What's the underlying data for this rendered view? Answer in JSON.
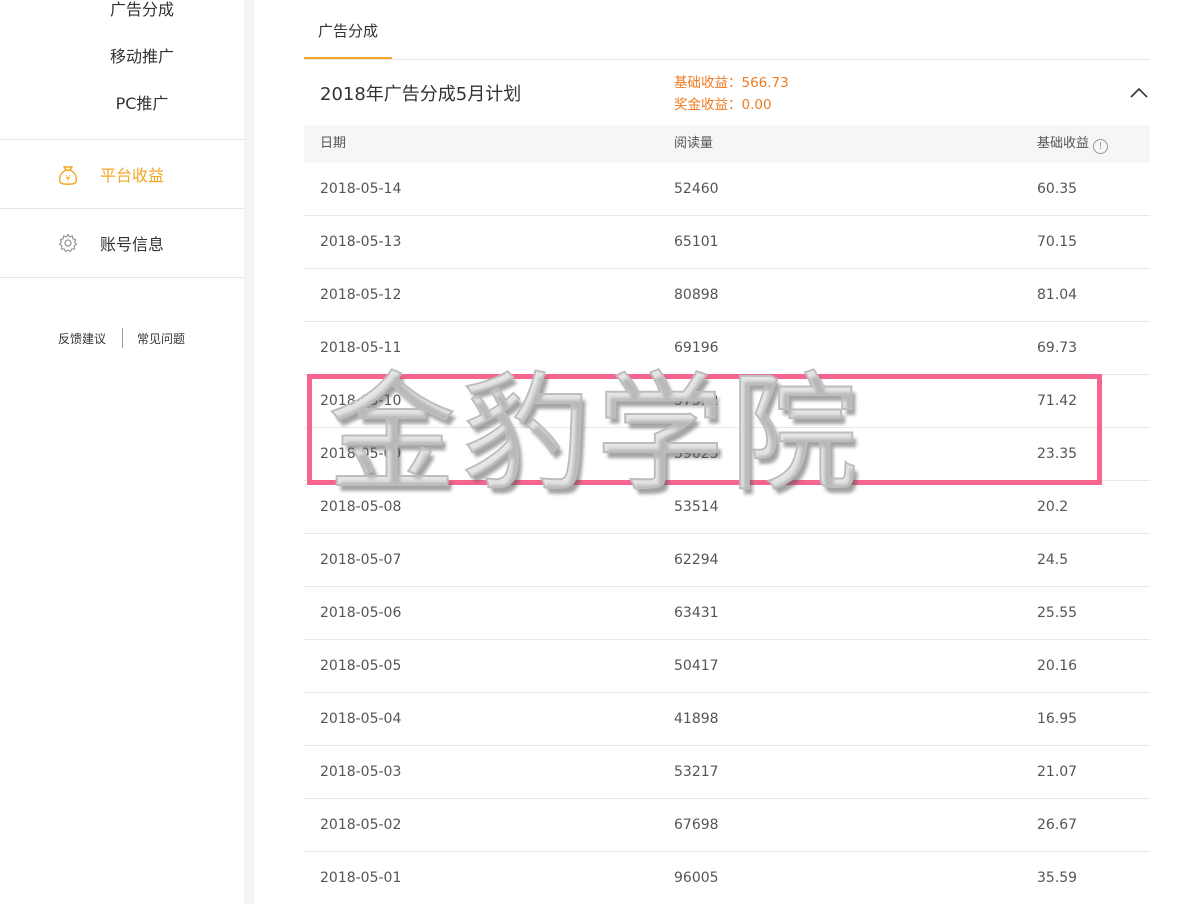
{
  "sidebar": {
    "sub_items": [
      {
        "label": "广告分成"
      },
      {
        "label": "移动推广"
      },
      {
        "label": "PC推广"
      }
    ],
    "nav": [
      {
        "label": "平台收益",
        "icon": "money-bag-icon",
        "active": true
      },
      {
        "label": "账号信息",
        "icon": "gear-icon",
        "active": false
      }
    ],
    "footer": {
      "feedback": "反馈建议",
      "faq": "常见问题"
    }
  },
  "tabs": [
    {
      "label": "广告分成",
      "active": true
    }
  ],
  "plan": {
    "title": "2018年广告分成5月计划",
    "base_income": "基础收益：566.73",
    "bonus_income": "奖金收益：0.00",
    "collapse_icon": "chevron-up-icon"
  },
  "table": {
    "headers": {
      "date": "日期",
      "reads": "阅读量",
      "income": "基础收益"
    },
    "rows": [
      {
        "date": "2018-05-14",
        "reads": "52460",
        "income": "60.35"
      },
      {
        "date": "2018-05-13",
        "reads": "65101",
        "income": "70.15"
      },
      {
        "date": "2018-05-12",
        "reads": "80898",
        "income": "81.04"
      },
      {
        "date": "2018-05-11",
        "reads": "69196",
        "income": "69.73"
      },
      {
        "date": "2018-05-10",
        "reads": "57512",
        "income": "71.42"
      },
      {
        "date": "2018-05-09",
        "reads": "59023",
        "income": "23.35"
      },
      {
        "date": "2018-05-08",
        "reads": "53514",
        "income": "20.2"
      },
      {
        "date": "2018-05-07",
        "reads": "62294",
        "income": "24.5"
      },
      {
        "date": "2018-05-06",
        "reads": "63431",
        "income": "25.55"
      },
      {
        "date": "2018-05-05",
        "reads": "50417",
        "income": "20.16"
      },
      {
        "date": "2018-05-04",
        "reads": "41898",
        "income": "16.95"
      },
      {
        "date": "2018-05-03",
        "reads": "53217",
        "income": "21.07"
      },
      {
        "date": "2018-05-02",
        "reads": "67698",
        "income": "26.67"
      },
      {
        "date": "2018-05-01",
        "reads": "96005",
        "income": "35.59"
      }
    ]
  },
  "overlay": {
    "watermark": "金豹学院",
    "highlight_color": "#f7658f"
  },
  "colors": {
    "accent": "#f5a623",
    "income_text": "#f07b20"
  }
}
